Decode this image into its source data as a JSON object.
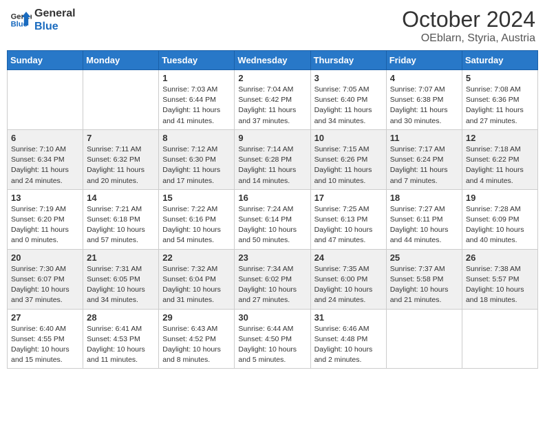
{
  "header": {
    "logo_line1": "General",
    "logo_line2": "Blue",
    "month": "October 2024",
    "location": "OEblarn, Styria, Austria"
  },
  "weekdays": [
    "Sunday",
    "Monday",
    "Tuesday",
    "Wednesday",
    "Thursday",
    "Friday",
    "Saturday"
  ],
  "weeks": [
    [
      {
        "day": "",
        "sunrise": "",
        "sunset": "",
        "daylight": ""
      },
      {
        "day": "",
        "sunrise": "",
        "sunset": "",
        "daylight": ""
      },
      {
        "day": "1",
        "sunrise": "Sunrise: 7:03 AM",
        "sunset": "Sunset: 6:44 PM",
        "daylight": "Daylight: 11 hours and 41 minutes."
      },
      {
        "day": "2",
        "sunrise": "Sunrise: 7:04 AM",
        "sunset": "Sunset: 6:42 PM",
        "daylight": "Daylight: 11 hours and 37 minutes."
      },
      {
        "day": "3",
        "sunrise": "Sunrise: 7:05 AM",
        "sunset": "Sunset: 6:40 PM",
        "daylight": "Daylight: 11 hours and 34 minutes."
      },
      {
        "day": "4",
        "sunrise": "Sunrise: 7:07 AM",
        "sunset": "Sunset: 6:38 PM",
        "daylight": "Daylight: 11 hours and 30 minutes."
      },
      {
        "day": "5",
        "sunrise": "Sunrise: 7:08 AM",
        "sunset": "Sunset: 6:36 PM",
        "daylight": "Daylight: 11 hours and 27 minutes."
      }
    ],
    [
      {
        "day": "6",
        "sunrise": "Sunrise: 7:10 AM",
        "sunset": "Sunset: 6:34 PM",
        "daylight": "Daylight: 11 hours and 24 minutes."
      },
      {
        "day": "7",
        "sunrise": "Sunrise: 7:11 AM",
        "sunset": "Sunset: 6:32 PM",
        "daylight": "Daylight: 11 hours and 20 minutes."
      },
      {
        "day": "8",
        "sunrise": "Sunrise: 7:12 AM",
        "sunset": "Sunset: 6:30 PM",
        "daylight": "Daylight: 11 hours and 17 minutes."
      },
      {
        "day": "9",
        "sunrise": "Sunrise: 7:14 AM",
        "sunset": "Sunset: 6:28 PM",
        "daylight": "Daylight: 11 hours and 14 minutes."
      },
      {
        "day": "10",
        "sunrise": "Sunrise: 7:15 AM",
        "sunset": "Sunset: 6:26 PM",
        "daylight": "Daylight: 11 hours and 10 minutes."
      },
      {
        "day": "11",
        "sunrise": "Sunrise: 7:17 AM",
        "sunset": "Sunset: 6:24 PM",
        "daylight": "Daylight: 11 hours and 7 minutes."
      },
      {
        "day": "12",
        "sunrise": "Sunrise: 7:18 AM",
        "sunset": "Sunset: 6:22 PM",
        "daylight": "Daylight: 11 hours and 4 minutes."
      }
    ],
    [
      {
        "day": "13",
        "sunrise": "Sunrise: 7:19 AM",
        "sunset": "Sunset: 6:20 PM",
        "daylight": "Daylight: 11 hours and 0 minutes."
      },
      {
        "day": "14",
        "sunrise": "Sunrise: 7:21 AM",
        "sunset": "Sunset: 6:18 PM",
        "daylight": "Daylight: 10 hours and 57 minutes."
      },
      {
        "day": "15",
        "sunrise": "Sunrise: 7:22 AM",
        "sunset": "Sunset: 6:16 PM",
        "daylight": "Daylight: 10 hours and 54 minutes."
      },
      {
        "day": "16",
        "sunrise": "Sunrise: 7:24 AM",
        "sunset": "Sunset: 6:14 PM",
        "daylight": "Daylight: 10 hours and 50 minutes."
      },
      {
        "day": "17",
        "sunrise": "Sunrise: 7:25 AM",
        "sunset": "Sunset: 6:13 PM",
        "daylight": "Daylight: 10 hours and 47 minutes."
      },
      {
        "day": "18",
        "sunrise": "Sunrise: 7:27 AM",
        "sunset": "Sunset: 6:11 PM",
        "daylight": "Daylight: 10 hours and 44 minutes."
      },
      {
        "day": "19",
        "sunrise": "Sunrise: 7:28 AM",
        "sunset": "Sunset: 6:09 PM",
        "daylight": "Daylight: 10 hours and 40 minutes."
      }
    ],
    [
      {
        "day": "20",
        "sunrise": "Sunrise: 7:30 AM",
        "sunset": "Sunset: 6:07 PM",
        "daylight": "Daylight: 10 hours and 37 minutes."
      },
      {
        "day": "21",
        "sunrise": "Sunrise: 7:31 AM",
        "sunset": "Sunset: 6:05 PM",
        "daylight": "Daylight: 10 hours and 34 minutes."
      },
      {
        "day": "22",
        "sunrise": "Sunrise: 7:32 AM",
        "sunset": "Sunset: 6:04 PM",
        "daylight": "Daylight: 10 hours and 31 minutes."
      },
      {
        "day": "23",
        "sunrise": "Sunrise: 7:34 AM",
        "sunset": "Sunset: 6:02 PM",
        "daylight": "Daylight: 10 hours and 27 minutes."
      },
      {
        "day": "24",
        "sunrise": "Sunrise: 7:35 AM",
        "sunset": "Sunset: 6:00 PM",
        "daylight": "Daylight: 10 hours and 24 minutes."
      },
      {
        "day": "25",
        "sunrise": "Sunrise: 7:37 AM",
        "sunset": "Sunset: 5:58 PM",
        "daylight": "Daylight: 10 hours and 21 minutes."
      },
      {
        "day": "26",
        "sunrise": "Sunrise: 7:38 AM",
        "sunset": "Sunset: 5:57 PM",
        "daylight": "Daylight: 10 hours and 18 minutes."
      }
    ],
    [
      {
        "day": "27",
        "sunrise": "Sunrise: 6:40 AM",
        "sunset": "Sunset: 4:55 PM",
        "daylight": "Daylight: 10 hours and 15 minutes."
      },
      {
        "day": "28",
        "sunrise": "Sunrise: 6:41 AM",
        "sunset": "Sunset: 4:53 PM",
        "daylight": "Daylight: 10 hours and 11 minutes."
      },
      {
        "day": "29",
        "sunrise": "Sunrise: 6:43 AM",
        "sunset": "Sunset: 4:52 PM",
        "daylight": "Daylight: 10 hours and 8 minutes."
      },
      {
        "day": "30",
        "sunrise": "Sunrise: 6:44 AM",
        "sunset": "Sunset: 4:50 PM",
        "daylight": "Daylight: 10 hours and 5 minutes."
      },
      {
        "day": "31",
        "sunrise": "Sunrise: 6:46 AM",
        "sunset": "Sunset: 4:48 PM",
        "daylight": "Daylight: 10 hours and 2 minutes."
      },
      {
        "day": "",
        "sunrise": "",
        "sunset": "",
        "daylight": ""
      },
      {
        "day": "",
        "sunrise": "",
        "sunset": "",
        "daylight": ""
      }
    ]
  ]
}
